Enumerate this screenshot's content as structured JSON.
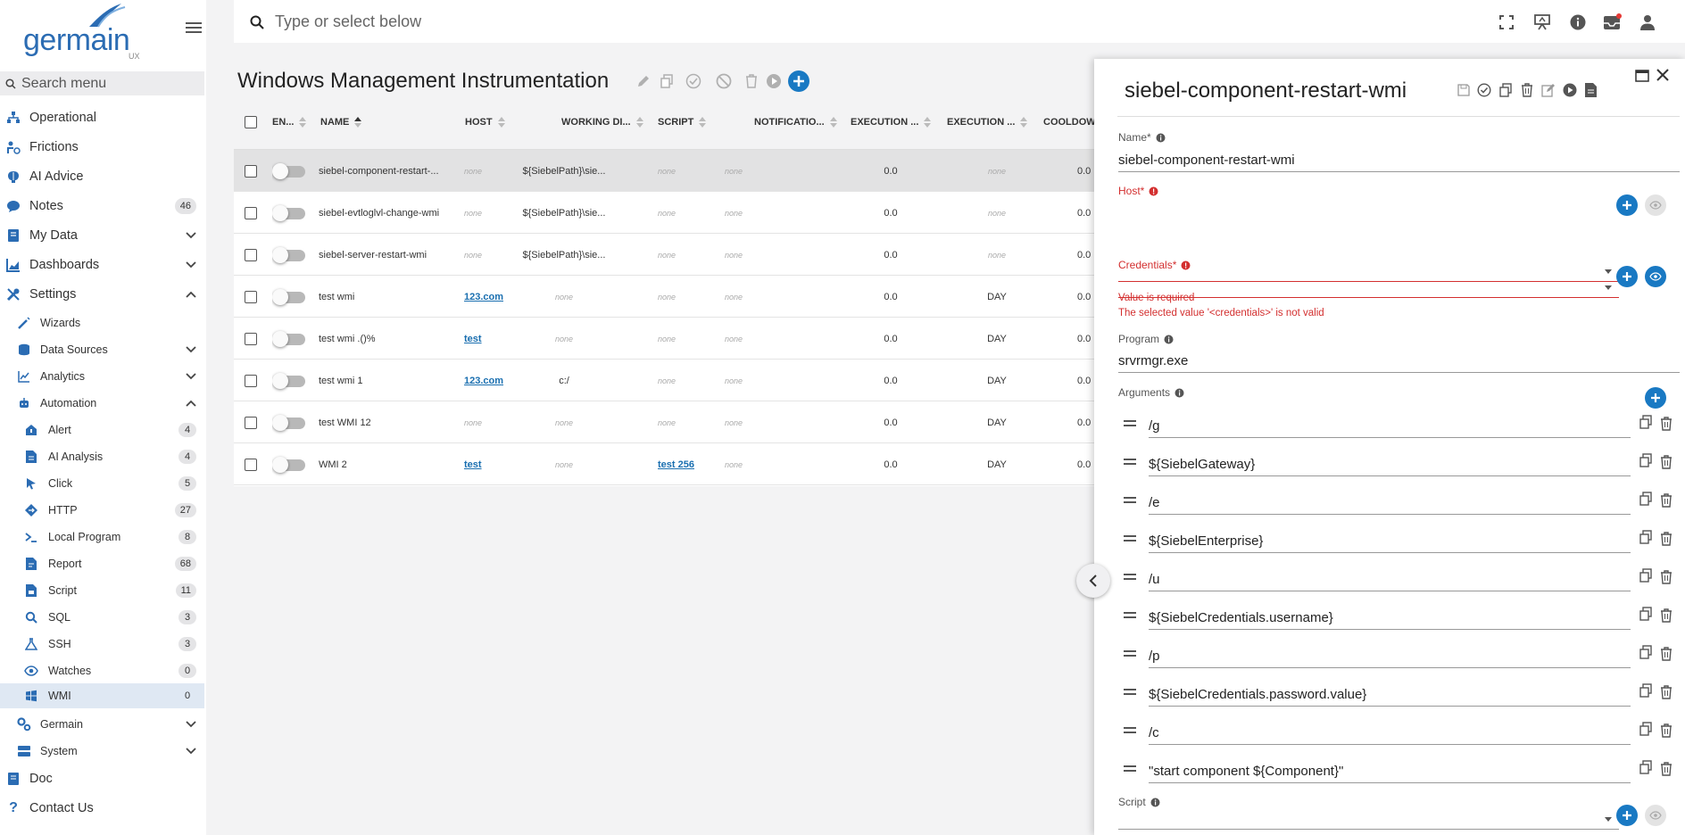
{
  "app": {
    "logo_word": "germain",
    "logo_suffix": "UX"
  },
  "sidebar": {
    "search_placeholder": "Search menu",
    "items": {
      "operational": "Operational",
      "frictions": "Frictions",
      "ai_advice": "AI Advice",
      "notes": "Notes",
      "notes_count": "46",
      "my_data": "My Data",
      "dashboards": "Dashboards",
      "settings": "Settings",
      "wizards": "Wizards",
      "data_sources": "Data Sources",
      "analytics": "Analytics",
      "automation": "Automation",
      "alert": "Alert",
      "alert_count": "4",
      "ai_analysis": "AI Analysis",
      "ai_analysis_count": "4",
      "click": "Click",
      "click_count": "5",
      "http": "HTTP",
      "http_count": "27",
      "local_program": "Local Program",
      "local_program_count": "8",
      "report": "Report",
      "report_count": "68",
      "script": "Script",
      "script_count": "11",
      "sql": "SQL",
      "sql_count": "3",
      "ssh": "SSH",
      "ssh_count": "3",
      "watches": "Watches",
      "watches_count": "0",
      "wmi": "WMI",
      "wmi_count": "0",
      "germain": "Germain",
      "system": "System",
      "doc": "Doc",
      "contact_us": "Contact Us"
    }
  },
  "topbar": {
    "search_placeholder": "Type or select below"
  },
  "main": {
    "title": "Windows Management Instrumentation",
    "columns": {
      "enabled": "EN...",
      "name": "NAME",
      "host": "HOST",
      "working_dir": "WORKING DI...",
      "script": "SCRIPT",
      "notifications": "NOTIFICATIO...",
      "execution1": "EXECUTION ...",
      "execution2": "EXECUTION ...",
      "cooldown": "COOLDOW"
    },
    "rows": [
      {
        "name": "siebel-component-restart-...",
        "host": "none",
        "host_link": false,
        "working_dir": "${SiebelPath}\\sie...",
        "working_dir_none": false,
        "script": "none",
        "script_link": false,
        "notifications": "none",
        "exec1": "0.0",
        "exec2": "none",
        "exec2_none": true,
        "cooldown": "0.0",
        "selected": true
      },
      {
        "name": "siebel-evtloglvl-change-wmi",
        "host": "none",
        "host_link": false,
        "working_dir": "${SiebelPath}\\sie...",
        "working_dir_none": false,
        "script": "none",
        "script_link": false,
        "notifications": "none",
        "exec1": "0.0",
        "exec2": "none",
        "exec2_none": true,
        "cooldown": "0.0",
        "selected": false
      },
      {
        "name": "siebel-server-restart-wmi",
        "host": "none",
        "host_link": false,
        "working_dir": "${SiebelPath}\\sie...",
        "working_dir_none": false,
        "script": "none",
        "script_link": false,
        "notifications": "none",
        "exec1": "0.0",
        "exec2": "none",
        "exec2_none": true,
        "cooldown": "0.0",
        "selected": false
      },
      {
        "name": "test wmi",
        "host": "123.com",
        "host_link": true,
        "working_dir": "none",
        "working_dir_none": true,
        "script": "none",
        "script_link": false,
        "notifications": "none",
        "exec1": "0.0",
        "exec2": "DAY",
        "exec2_none": false,
        "cooldown": "0.0",
        "selected": false
      },
      {
        "name": "test wmi .()%",
        "host": "test",
        "host_link": true,
        "working_dir": "none",
        "working_dir_none": true,
        "script": "none",
        "script_link": false,
        "notifications": "none",
        "exec1": "0.0",
        "exec2": "DAY",
        "exec2_none": false,
        "cooldown": "0.0",
        "selected": false
      },
      {
        "name": "test wmi 1",
        "host": "123.com",
        "host_link": true,
        "working_dir": "c:/",
        "working_dir_none": false,
        "script": "none",
        "script_link": false,
        "notifications": "none",
        "exec1": "0.0",
        "exec2": "DAY",
        "exec2_none": false,
        "cooldown": "0.0",
        "selected": false
      },
      {
        "name": "test WMI 12",
        "host": "none",
        "host_link": false,
        "working_dir": "none",
        "working_dir_none": true,
        "script": "none",
        "script_link": false,
        "notifications": "none",
        "exec1": "0.0",
        "exec2": "DAY",
        "exec2_none": false,
        "cooldown": "0.0",
        "selected": false
      },
      {
        "name": "WMI 2",
        "host": "test",
        "host_link": true,
        "working_dir": "none",
        "working_dir_none": true,
        "script": "test 256",
        "script_link": true,
        "notifications": "none",
        "exec1": "0.0",
        "exec2": "DAY",
        "exec2_none": false,
        "cooldown": "0.0",
        "selected": false
      }
    ]
  },
  "panel": {
    "title": "siebel-component-restart-wmi",
    "name_label": "Name*",
    "name_value": "siebel-component-restart-wmi",
    "host_label": "Host*",
    "host_error": "Value is required",
    "credentials_label": "Credentials*",
    "credentials_error": "The selected value '<credentials>' is not valid",
    "program_label": "Program",
    "program_value": "srvrmgr.exe",
    "arguments_label": "Arguments",
    "arguments": [
      "/g",
      "${SiebelGateway}",
      "/e",
      "${SiebelEnterprise}",
      "/u",
      "${SiebelCredentials.username}",
      "/p",
      "${SiebelCredentials.password.value}",
      "/c",
      "\"start component ${Component}\""
    ],
    "script_label": "Script"
  },
  "colors": {
    "accent": "#1979c3",
    "error": "#d32f2f",
    "link": "#1a6fb0",
    "selected_row": "#e2e2e3",
    "active_nav": "#dfe8f3"
  }
}
